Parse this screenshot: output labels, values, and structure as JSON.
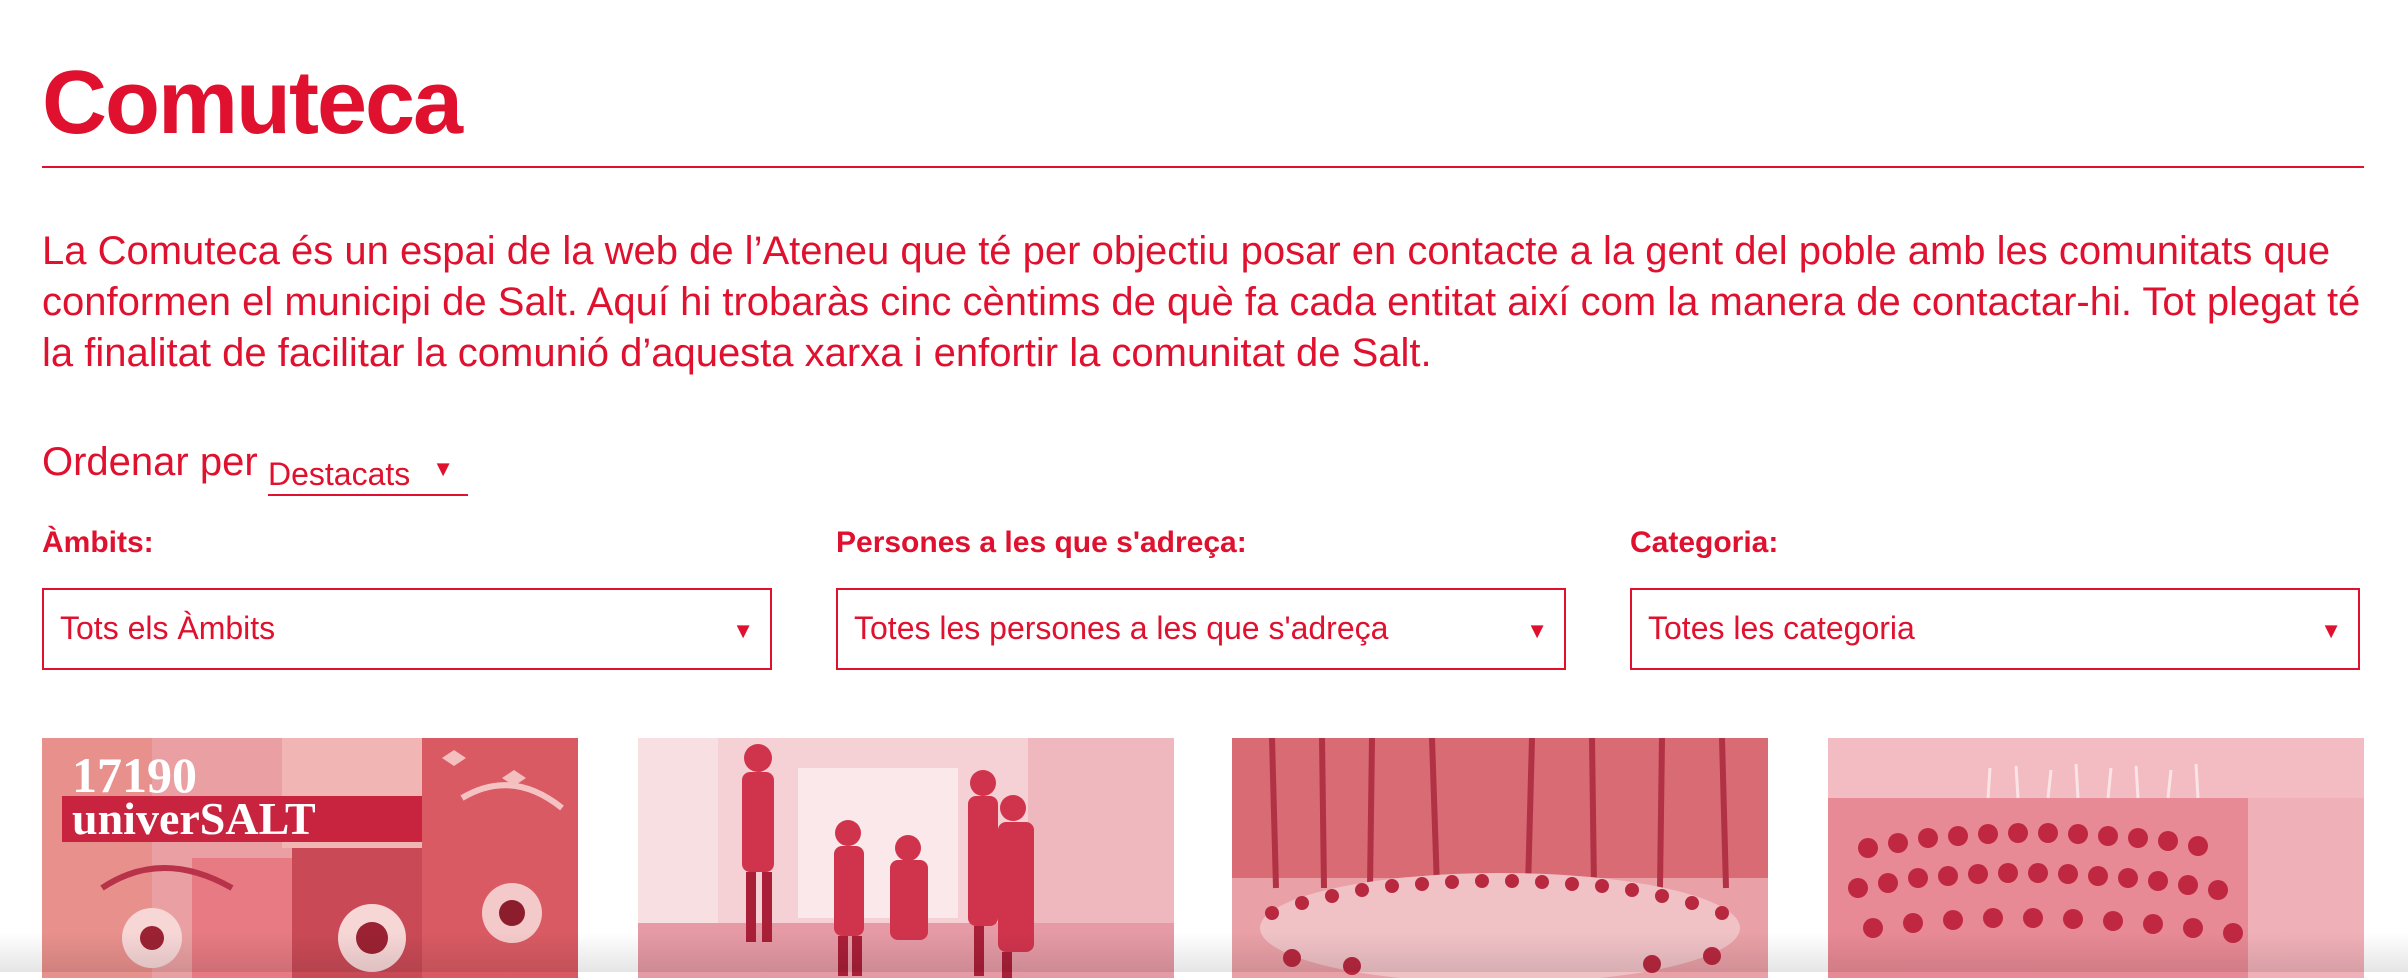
{
  "page": {
    "title": "Comuteca",
    "intro": "La Comuteca és un espai de la web de l’Ateneu que té per objectiu posar en contacte a la gent del poble amb les comunitats que conformen el municipi de Salt. Aquí hi trobaràs cinc cèntims de què fa cada entitat així com la manera de contactar-hi. Tot plegat té la finalitat de facilitar la comunió d’aquesta xarxa i enfortir la comunitat de Salt."
  },
  "sort": {
    "label": "Ordenar per",
    "value": "Destacats",
    "caret": "▼"
  },
  "filters": [
    {
      "label": "Àmbits:",
      "value": "Tots els Àmbits",
      "caret": "▼"
    },
    {
      "label": "Persones a les que s'adreça:",
      "value": "Totes les persones a les que s'adreça",
      "caret": "▼"
    },
    {
      "label": "Categoria:",
      "value": "Totes les categoria",
      "caret": "▼"
    }
  ],
  "cards": [
    {
      "image_text_line1": "17190",
      "image_text_line2": "univerSALT"
    }
  ],
  "colors": {
    "accent": "#e0102f",
    "background": "#ffffff",
    "image_tint": "#f2a9b3"
  }
}
